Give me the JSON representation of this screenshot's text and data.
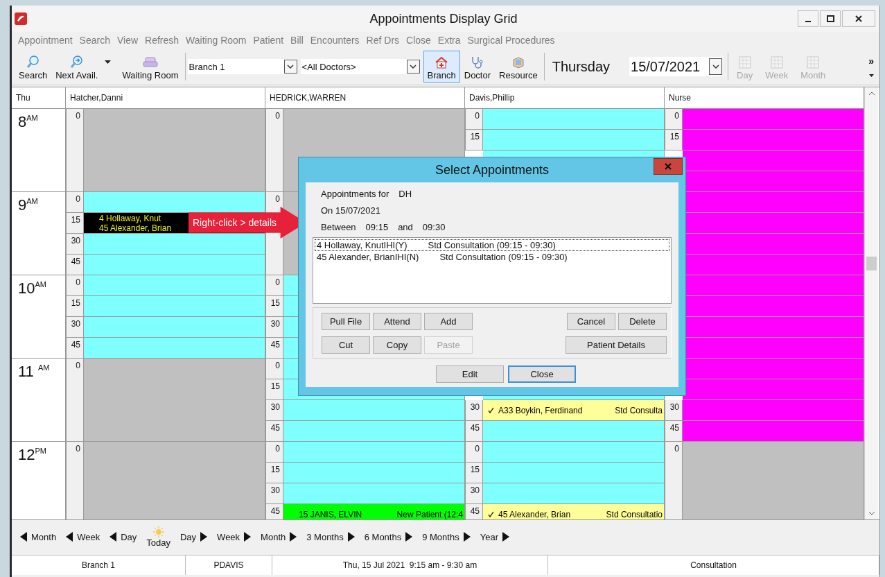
{
  "window": {
    "title": "Appointments Display Grid"
  },
  "menu": [
    "Appointment",
    "Search",
    "View",
    "Refresh",
    "Waiting Room",
    "Patient",
    "Bill",
    "Encounters",
    "Ref Drs",
    "Close",
    "Extra",
    "Surgical Procedures"
  ],
  "toolbar": {
    "left_tools": [
      {
        "label": "Search",
        "kind": "search"
      },
      {
        "label": "Next Avail.",
        "kind": "next"
      },
      {
        "kind": "dropdown"
      },
      {
        "label": "Waiting Room",
        "kind": "sofa"
      }
    ],
    "branch_select": {
      "value": "Branch 1"
    },
    "doctor_select": {
      "value": "<All Doctors>"
    },
    "scope_tools": [
      {
        "label": "Branch",
        "kind": "house",
        "selected": true
      },
      {
        "label": "Doctor",
        "kind": "stethoscope",
        "selected": false
      },
      {
        "label": "Resource",
        "kind": "resource",
        "selected": false
      }
    ],
    "day_name": "Thursday",
    "date": {
      "value": "15/07/2021"
    },
    "view_tools": [
      {
        "label": "Day",
        "disabled": true
      },
      {
        "label": "Week",
        "disabled": true
      },
      {
        "label": "Month",
        "disabled": true
      }
    ],
    "overflow": "»"
  },
  "grid": {
    "corner": "Thu",
    "hours": [
      "8$^{AM}$",
      "9$^{AM}$",
      "10$^{AM}$",
      "11 $^{AM}$",
      "12$^{PM}$"
    ],
    "columns": [
      {
        "name": "Hatcher,Danni",
        "hours": [
          [
            {
              "minute": "0",
              "color": "#c0c0c0"
            }
          ],
          [
            {
              "minute": "0",
              "color": "#80ffff"
            },
            {
              "minute": "15",
              "color": "#000000",
              "appointment": {
                "checked": false,
                "patients": [
                  "4 Hollaway, Knut",
                  "45 Alexander, Brian"
                ]
              }
            },
            {
              "minute": "30",
              "color": "#80ffff"
            },
            {
              "minute": "45",
              "color": "#80ffff"
            }
          ],
          [
            {
              "minute": "0",
              "color": "#80ffff"
            },
            {
              "minute": "15",
              "color": "#80ffff"
            },
            {
              "minute": "30",
              "color": "#80ffff"
            },
            {
              "minute": "45",
              "color": "#80ffff"
            }
          ],
          [
            {
              "minute": "0",
              "color": "#c0c0c0"
            }
          ],
          [
            {
              "minute": "0",
              "color": "#c0c0c0"
            }
          ]
        ]
      },
      {
        "name": "HEDRICK,WARREN",
        "hours": [
          [
            {
              "minute": "0",
              "color": "#c0c0c0"
            }
          ],
          [
            {
              "minute": "0",
              "color": "#c0c0c0"
            }
          ],
          [
            {
              "minute": "0",
              "color": "#80ffff"
            },
            {
              "minute": "15",
              "color": "#80ffff"
            },
            {
              "minute": "30",
              "color": "#80ffff"
            },
            {
              "minute": "45",
              "color": "#80ffff"
            }
          ],
          [
            {
              "minute": "0",
              "color": "#80ffff"
            },
            {
              "minute": "15",
              "color": "#80ffff"
            },
            {
              "minute": "30",
              "color": "#80ffff"
            },
            {
              "minute": "45",
              "color": "#80ffff"
            }
          ],
          [
            {
              "minute": "0",
              "color": "#80ffff"
            },
            {
              "minute": "15",
              "color": "#80ffff"
            },
            {
              "minute": "30",
              "color": "#80ffff"
            },
            {
              "minute": "45",
              "color": "#00ff00",
              "appointment": {
                "checked": false,
                "patients": [
                  "15 JANIS, ELVIN"
                ],
                "type": "New Patient (12:4"
              }
            }
          ]
        ]
      },
      {
        "name": "Davis,Phillip",
        "upper_slots": [
          {
            "minute": "0",
            "color": "#80ffff"
          },
          {
            "minute": "15",
            "color": "#80ffff"
          },
          {
            "color": "#80ffff"
          }
        ],
        "lower_slots": [
          {
            "color": "#80ffff"
          },
          {
            "minute": "30",
            "color": "#ffff99",
            "appointment": {
              "checked": true,
              "patients": [
                "A33 Boykin, Ferdinand"
              ],
              "type": "Std Consulta"
            }
          },
          {
            "minute": "45",
            "color": "#80ffff"
          },
          {
            "minute": "0",
            "color": "#80ffff"
          },
          {
            "minute": "15",
            "color": "#80ffff"
          },
          {
            "minute": "30",
            "color": "#80ffff"
          },
          {
            "minute": "45",
            "color": "#ffff99",
            "appointment": {
              "checked": true,
              "patients": [
                "45 Alexander, Brian"
              ],
              "type": "Std Consultatio"
            }
          }
        ]
      },
      {
        "name": "Nurse",
        "hours": [
          [
            {
              "minute": "0",
              "color": "#ff00ff"
            },
            {
              "minute": "15",
              "color": "#ff00ff"
            },
            {
              "color": "#ff00ff"
            },
            {
              "color": "#ff00ff"
            }
          ],
          [
            {
              "color": "#ff00ff"
            },
            {
              "color": "#ff00ff"
            },
            {
              "color": "#ff00ff"
            },
            {
              "color": "#ff00ff"
            }
          ],
          [
            {
              "color": "#ff00ff"
            },
            {
              "color": "#ff00ff"
            },
            {
              "color": "#ff00ff"
            },
            {
              "color": "#ff00ff"
            }
          ],
          [
            {
              "color": "#ff00ff"
            },
            {
              "color": "#ff00ff"
            },
            {
              "minute": "30",
              "color": "#ff00ff"
            },
            {
              "minute": "45",
              "color": "#ff00ff"
            }
          ],
          [
            {
              "minute": "0",
              "color": "#c0c0c0"
            }
          ]
        ]
      }
    ]
  },
  "callout": {
    "text": "Right-click > details"
  },
  "dialog": {
    "title": "Select Appointments",
    "for_label": "Appointments for",
    "for_value": "DH",
    "on_text": "On 15/07/2021",
    "between_label": "Between",
    "from": "09:15",
    "and_label": "and",
    "to": "09:30",
    "list": [
      {
        "patient": "4 Hollaway, KnutIHI(Y)",
        "type": "Std Consultation (09:15 - 09:30)",
        "selected": true
      },
      {
        "patient": "45 Alexander, BrianIHI(N)",
        "type": "Std Consultation (09:15 - 09:30)",
        "selected": false
      }
    ],
    "action_rows": [
      {
        "left": [
          {
            "label": "Pull File",
            "disabled": false
          },
          {
            "label": "Attend",
            "disabled": false
          },
          {
            "label": "Add",
            "disabled": false
          }
        ],
        "right": [
          {
            "label": "Cancel",
            "disabled": false
          },
          {
            "label": "Delete",
            "disabled": false
          }
        ]
      },
      {
        "left": [
          {
            "label": "Cut",
            "disabled": false
          },
          {
            "label": "Copy",
            "disabled": false
          },
          {
            "label": "Paste",
            "disabled": true
          }
        ],
        "right": [
          {
            "label": "Patient Details",
            "disabled": false
          }
        ]
      }
    ],
    "footer": [
      {
        "label": "Edit",
        "default": false
      },
      {
        "label": "Close",
        "default": true
      }
    ]
  },
  "nav": [
    {
      "label": "Month",
      "kind": "back"
    },
    {
      "label": "Week",
      "kind": "back"
    },
    {
      "label": "Day",
      "kind": "back"
    },
    {
      "label": "Today",
      "kind": "today"
    },
    {
      "label": "Day",
      "kind": "forward"
    },
    {
      "label": "Week",
      "kind": "forward"
    },
    {
      "label": "Month",
      "kind": "forward"
    },
    {
      "label": "3 Months",
      "kind": "forward"
    },
    {
      "label": "6 Months",
      "kind": "forward"
    },
    {
      "label": "9 Months",
      "kind": "forward"
    },
    {
      "label": "Year",
      "kind": "forward"
    }
  ],
  "status_bar": [
    "Branch 1",
    "PDAVIS",
    "Thu, 15 Jul 2021  9:15 am - 9:30 am",
    "Consultation"
  ]
}
